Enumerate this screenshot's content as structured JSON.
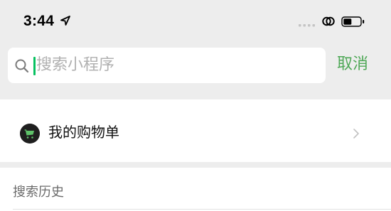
{
  "status_bar": {
    "time": "3:44",
    "icons": [
      "location-arrow-icon",
      "signal-icon",
      "link-icon",
      "battery-icon"
    ]
  },
  "search": {
    "placeholder": "搜索小程序",
    "cancel_label": "取消",
    "icon": "search-icon"
  },
  "shopping_list": {
    "label": "我的购物单",
    "icon": "shopping-cart-icon"
  },
  "history": {
    "title": "搜索历史"
  },
  "colors": {
    "accent": "#4fa857",
    "caret": "#07c160",
    "background": "#ededed",
    "placeholder": "#b0b0b0"
  }
}
